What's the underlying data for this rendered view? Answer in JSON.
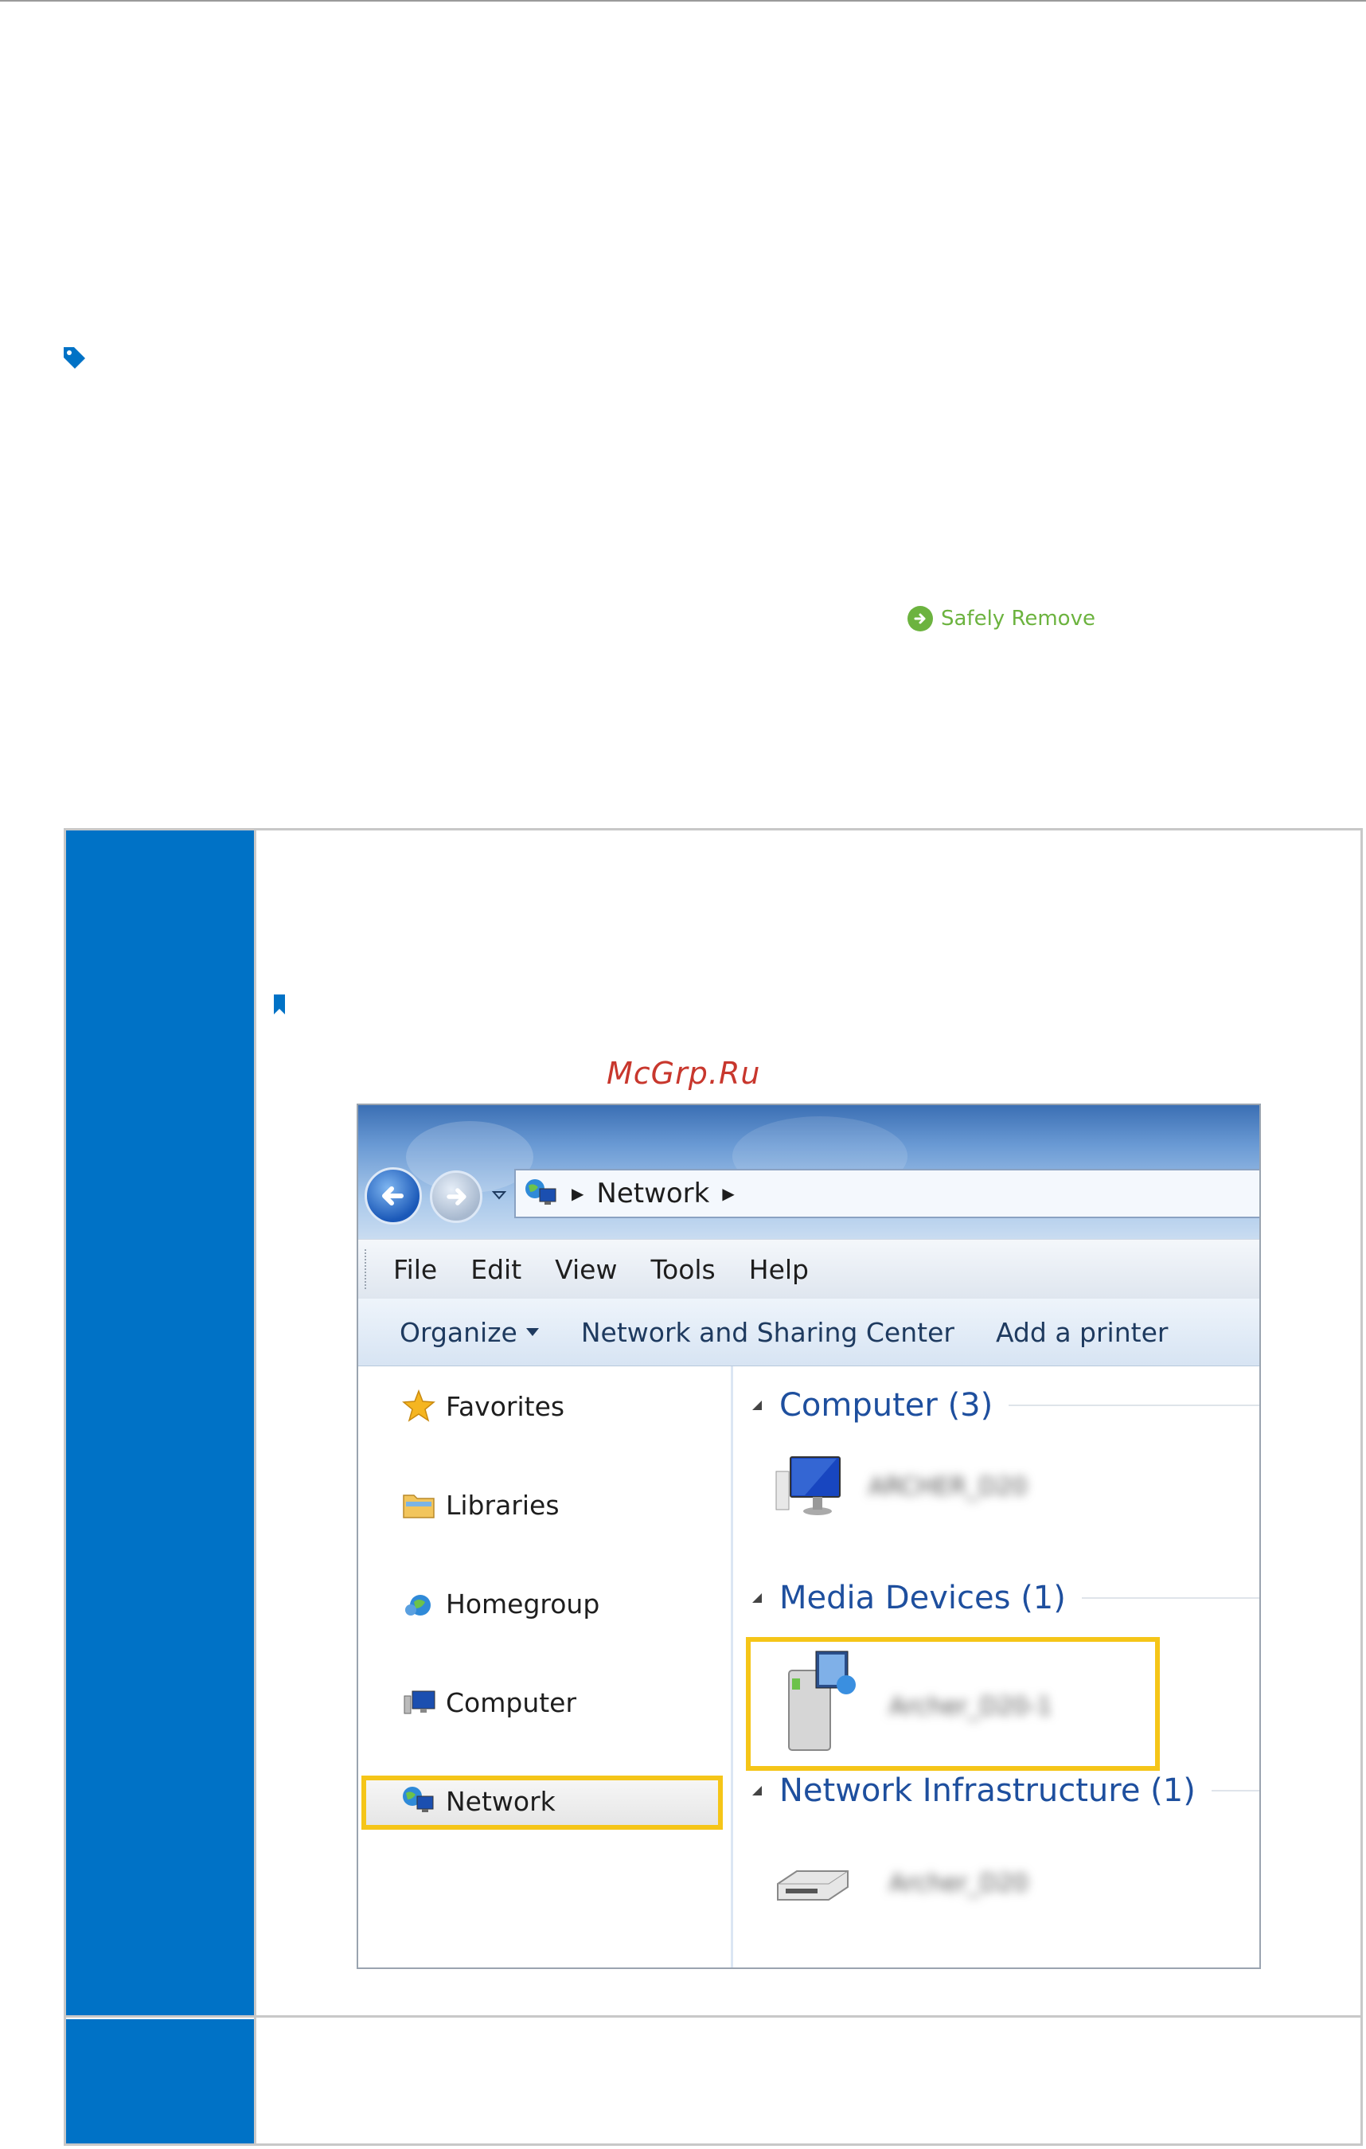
{
  "badge": {
    "label": "Safely Remove",
    "color": "#6cb33f"
  },
  "watermark": "McGrp.Ru",
  "explorer": {
    "address": {
      "crumb": "Network"
    },
    "menu": [
      "File",
      "Edit",
      "View",
      "Tools",
      "Help"
    ],
    "commands": {
      "organize": "Organize",
      "network_center": "Network and Sharing Center",
      "add_printer": "Add a printer"
    },
    "nav": {
      "favorites": "Favorites",
      "libraries": "Libraries",
      "homegroup": "Homegroup",
      "computer": "Computer",
      "network": "Network"
    },
    "groups": {
      "computer": {
        "label": "Computer (3)",
        "device": "ARCHER_D20"
      },
      "media": {
        "label": "Media Devices (1)",
        "device": "Archer_D20-1"
      },
      "infra": {
        "label": "Network Infrastructure (1)",
        "device": "Archer_D20"
      }
    }
  },
  "colors": {
    "primary_blue": "#0072c6",
    "highlight": "#f5c518",
    "watermark": "#c8372d"
  }
}
